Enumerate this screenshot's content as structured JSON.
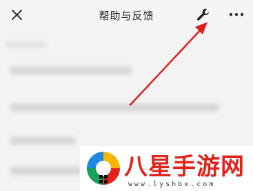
{
  "header": {
    "title": "帮助与反馈",
    "close_icon": "close-icon",
    "tool_icon": "wrench-icon",
    "more_icon": "more-dots-icon"
  },
  "annotation": {
    "color": "#e02020",
    "points_to": "wrench-icon"
  },
  "watermark": {
    "title": "八星手游网",
    "url": "www.lyshbx.com",
    "brand_color": "#e2231a"
  }
}
